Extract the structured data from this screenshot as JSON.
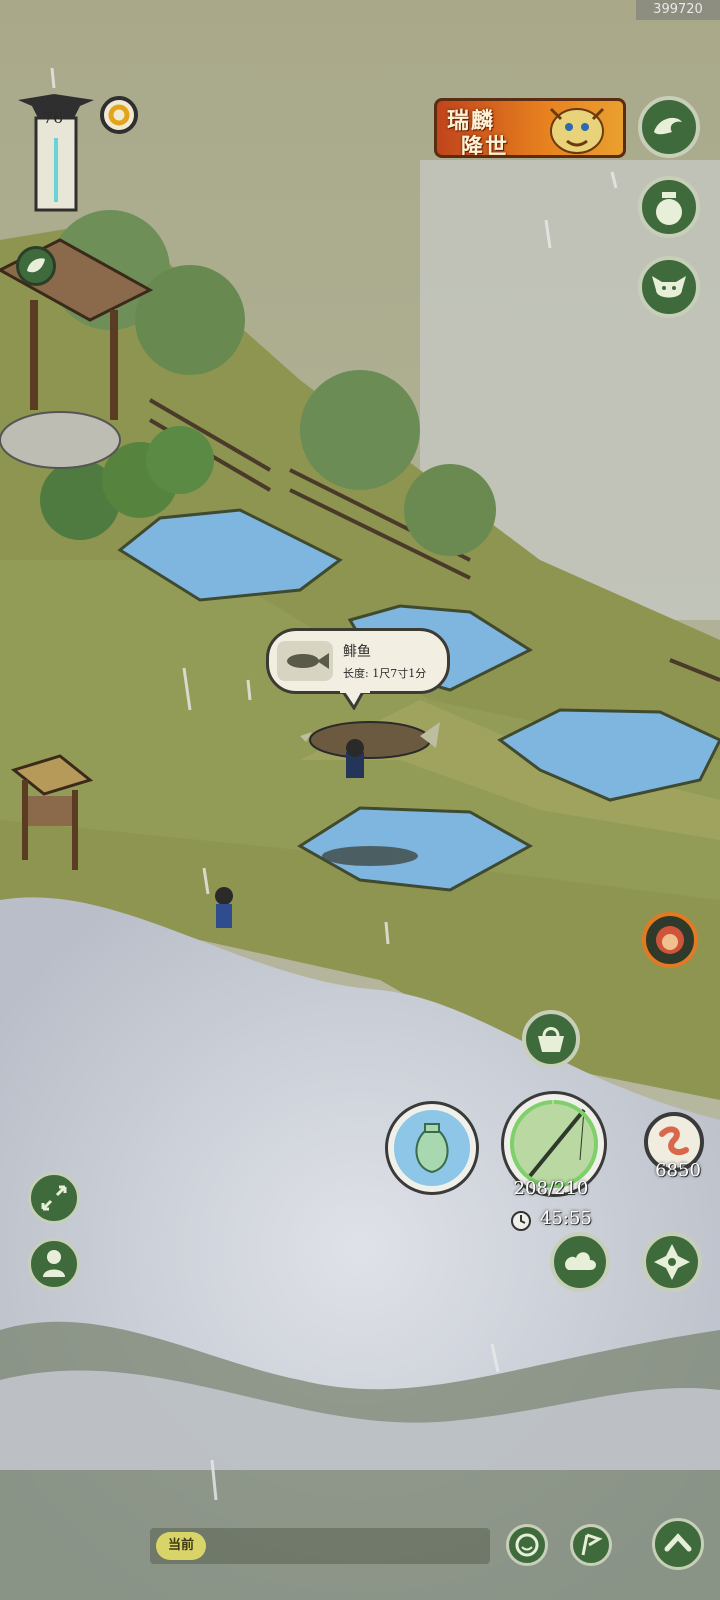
{
  "hud": {
    "id_badge": "399720",
    "level": "76"
  },
  "event_banner": {
    "line1": "瑞麟",
    "line2": "降世"
  },
  "catch_popup": {
    "fish_name": "鲱鱼",
    "length_text": "长度: 1尺7寸1分"
  },
  "fishing": {
    "stamina": "208/210",
    "stamina_fraction": 0.9905,
    "timer": "45:55",
    "bait_count": "6850"
  },
  "chat": {
    "channel_tag": "当前"
  },
  "colors": {
    "grass": "#8f9a54",
    "water": "#7fb6e0",
    "mist": "#cfd3d8",
    "button_green": "#3f6b3c",
    "banner_orange": "#e07a22"
  },
  "icons": {
    "right_top_1": "wave-icon",
    "right_top_2": "jar-icon",
    "right_top_3": "goblin-icon",
    "monk": "monk-face-icon",
    "basket": "basket-icon",
    "vase": "vase-icon",
    "rod": "fishing-rod-icon",
    "worm": "worm-bait-icon",
    "cloud": "cloud-icon",
    "compass": "compass-icon",
    "expand": "expand-icon",
    "avatar": "character-icon",
    "emoji": "smile-icon",
    "flag": "flag-icon",
    "up": "chevron-up-icon",
    "leaf": "leaf-icon",
    "coin": "coin-ring-icon"
  }
}
